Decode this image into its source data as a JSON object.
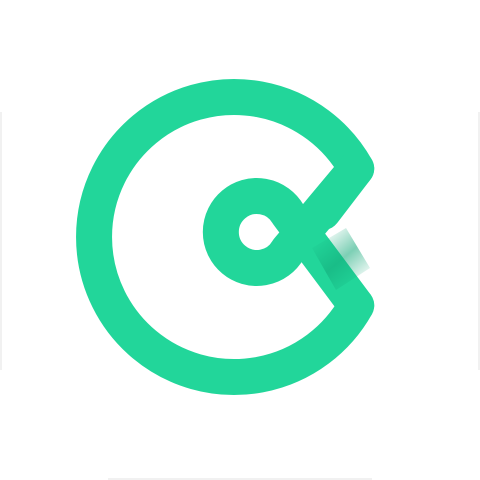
{
  "brand": {
    "icon": "app-logo-icon",
    "color": "#22d69a",
    "shade_color": "#12a878",
    "background": "#ffffff"
  }
}
